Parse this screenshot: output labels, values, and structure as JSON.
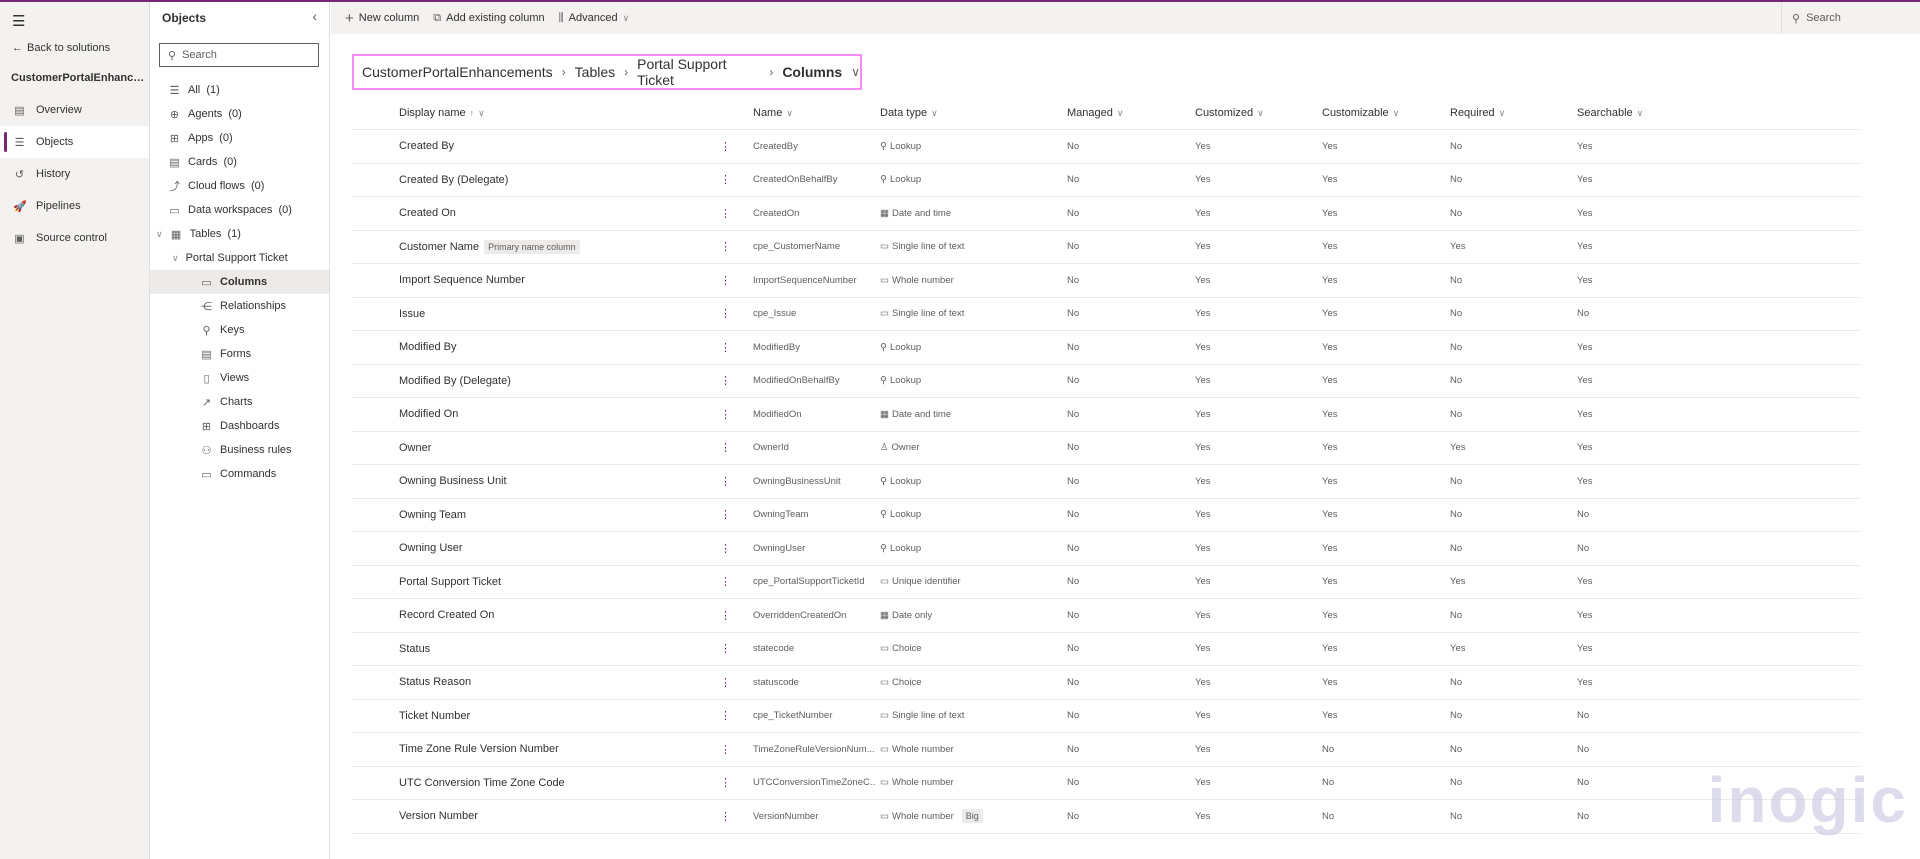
{
  "nav": {
    "back": "Back to solutions",
    "solution": "CustomerPortalEnhancements",
    "items": [
      {
        "label": "Overview",
        "icon": "overview-icon",
        "g": "▤"
      },
      {
        "label": "Objects",
        "icon": "objects-icon",
        "g": "☰",
        "selected": true
      },
      {
        "label": "History",
        "icon": "history-icon",
        "g": "↺"
      },
      {
        "label": "Pipelines",
        "icon": "pipelines-icon",
        "g": "🚀"
      },
      {
        "label": "Source control",
        "icon": "source-control-icon",
        "g": "▣"
      }
    ]
  },
  "objects": {
    "title": "Objects",
    "search_placeholder": "Search",
    "items": [
      {
        "label": "All  (1)",
        "icon": "list-icon",
        "g": "☰",
        "lvl": 0
      },
      {
        "label": "Agents  (0)",
        "icon": "agent-icon",
        "g": "⊕",
        "lvl": 0
      },
      {
        "label": "Apps  (0)",
        "icon": "apps-icon",
        "g": "⊞",
        "lvl": 0
      },
      {
        "label": "Cards  (0)",
        "icon": "cards-icon",
        "g": "▤",
        "lvl": 0
      },
      {
        "label": "Cloud flows  (0)",
        "icon": "flow-icon",
        "g": "⤴",
        "lvl": 0
      },
      {
        "label": "Data workspaces  (0)",
        "icon": "folder-icon",
        "g": "▭",
        "lvl": 0
      },
      {
        "label": "Tables  (1)",
        "icon": "table-icon",
        "g": "▦",
        "lvl": 0,
        "chev": true
      },
      {
        "label": "Portal Support Ticket",
        "icon": "",
        "g": "",
        "lvl": 1,
        "chev": true
      },
      {
        "label": "Columns",
        "icon": "columns-icon",
        "g": "▭",
        "lvl": 2,
        "selected": true
      },
      {
        "label": "Relationships",
        "icon": "relationships-icon",
        "g": "⋲",
        "lvl": 2
      },
      {
        "label": "Keys",
        "icon": "key-icon",
        "g": "⚲",
        "lvl": 2
      },
      {
        "label": "Forms",
        "icon": "forms-icon",
        "g": "▤",
        "lvl": 2
      },
      {
        "label": "Views",
        "icon": "views-icon",
        "g": "▯",
        "lvl": 2
      },
      {
        "label": "Charts",
        "icon": "charts-icon",
        "g": "↗",
        "lvl": 2
      },
      {
        "label": "Dashboards",
        "icon": "dashboard-icon",
        "g": "⊞",
        "lvl": 2
      },
      {
        "label": "Business rules",
        "icon": "business-rules-icon",
        "g": "⚇",
        "lvl": 2
      },
      {
        "label": "Commands",
        "icon": "commands-icon",
        "g": "▭",
        "lvl": 2
      }
    ]
  },
  "toolbar": {
    "new_column": "New column",
    "add_existing": "Add existing column",
    "advanced": "Advanced",
    "search": "Search"
  },
  "breadcrumb": [
    "CustomerPortalEnhancements",
    "Tables",
    "Portal Support Ticket",
    "Columns"
  ],
  "table": {
    "headers": [
      "Display name",
      "Name",
      "Data type",
      "Managed",
      "Customized",
      "Customizable",
      "Required",
      "Searchable"
    ],
    "rows": [
      [
        "Created By",
        "",
        "CreatedBy",
        "Lookup",
        "No",
        "Yes",
        "Yes",
        "No",
        "Yes"
      ],
      [
        "Created By (Delegate)",
        "",
        "CreatedOnBehalfBy",
        "Lookup",
        "No",
        "Yes",
        "Yes",
        "No",
        "Yes"
      ],
      [
        "Created On",
        "",
        "CreatedOn",
        "Date and time",
        "No",
        "Yes",
        "Yes",
        "No",
        "Yes"
      ],
      [
        "Customer Name",
        "Primary name column",
        "cpe_CustomerName",
        "Single line of text",
        "No",
        "Yes",
        "Yes",
        "Yes",
        "Yes"
      ],
      [
        "Import Sequence Number",
        "",
        "ImportSequenceNumber",
        "Whole number",
        "No",
        "Yes",
        "Yes",
        "No",
        "Yes"
      ],
      [
        "Issue",
        "",
        "cpe_Issue",
        "Single line of text",
        "No",
        "Yes",
        "Yes",
        "No",
        "No"
      ],
      [
        "Modified By",
        "",
        "ModifiedBy",
        "Lookup",
        "No",
        "Yes",
        "Yes",
        "No",
        "Yes"
      ],
      [
        "Modified By (Delegate)",
        "",
        "ModifiedOnBehalfBy",
        "Lookup",
        "No",
        "Yes",
        "Yes",
        "No",
        "Yes"
      ],
      [
        "Modified On",
        "",
        "ModifiedOn",
        "Date and time",
        "No",
        "Yes",
        "Yes",
        "No",
        "Yes"
      ],
      [
        "Owner",
        "",
        "OwnerId",
        "Owner",
        "No",
        "Yes",
        "Yes",
        "Yes",
        "Yes"
      ],
      [
        "Owning Business Unit",
        "",
        "OwningBusinessUnit",
        "Lookup",
        "No",
        "Yes",
        "Yes",
        "No",
        "Yes"
      ],
      [
        "Owning Team",
        "",
        "OwningTeam",
        "Lookup",
        "No",
        "Yes",
        "Yes",
        "No",
        "No"
      ],
      [
        "Owning User",
        "",
        "OwningUser",
        "Lookup",
        "No",
        "Yes",
        "Yes",
        "No",
        "No"
      ],
      [
        "Portal Support Ticket",
        "",
        "cpe_PortalSupportTicketId",
        "Unique identifier",
        "No",
        "Yes",
        "Yes",
        "Yes",
        "Yes"
      ],
      [
        "Record Created On",
        "",
        "OverriddenCreatedOn",
        "Date only",
        "No",
        "Yes",
        "Yes",
        "No",
        "Yes"
      ],
      [
        "Status",
        "",
        "statecode",
        "Choice",
        "No",
        "Yes",
        "Yes",
        "Yes",
        "Yes"
      ],
      [
        "Status Reason",
        "",
        "statuscode",
        "Choice",
        "No",
        "Yes",
        "Yes",
        "No",
        "Yes"
      ],
      [
        "Ticket Number",
        "",
        "cpe_TicketNumber",
        "Single line of text",
        "No",
        "Yes",
        "Yes",
        "No",
        "No"
      ],
      [
        "Time Zone Rule Version Number",
        "",
        "TimeZoneRuleVersionNum...",
        "Whole number",
        "No",
        "Yes",
        "No",
        "No",
        "No"
      ],
      [
        "UTC Conversion Time Zone Code",
        "",
        "UTCConversionTimeZoneC...",
        "Whole number",
        "No",
        "Yes",
        "No",
        "No",
        "No"
      ],
      [
        "Version Number",
        "",
        "VersionNumber",
        "Whole number",
        "No",
        "Yes",
        "No",
        "No",
        "No"
      ]
    ],
    "version_tag": "Big"
  },
  "watermark": "inogic"
}
